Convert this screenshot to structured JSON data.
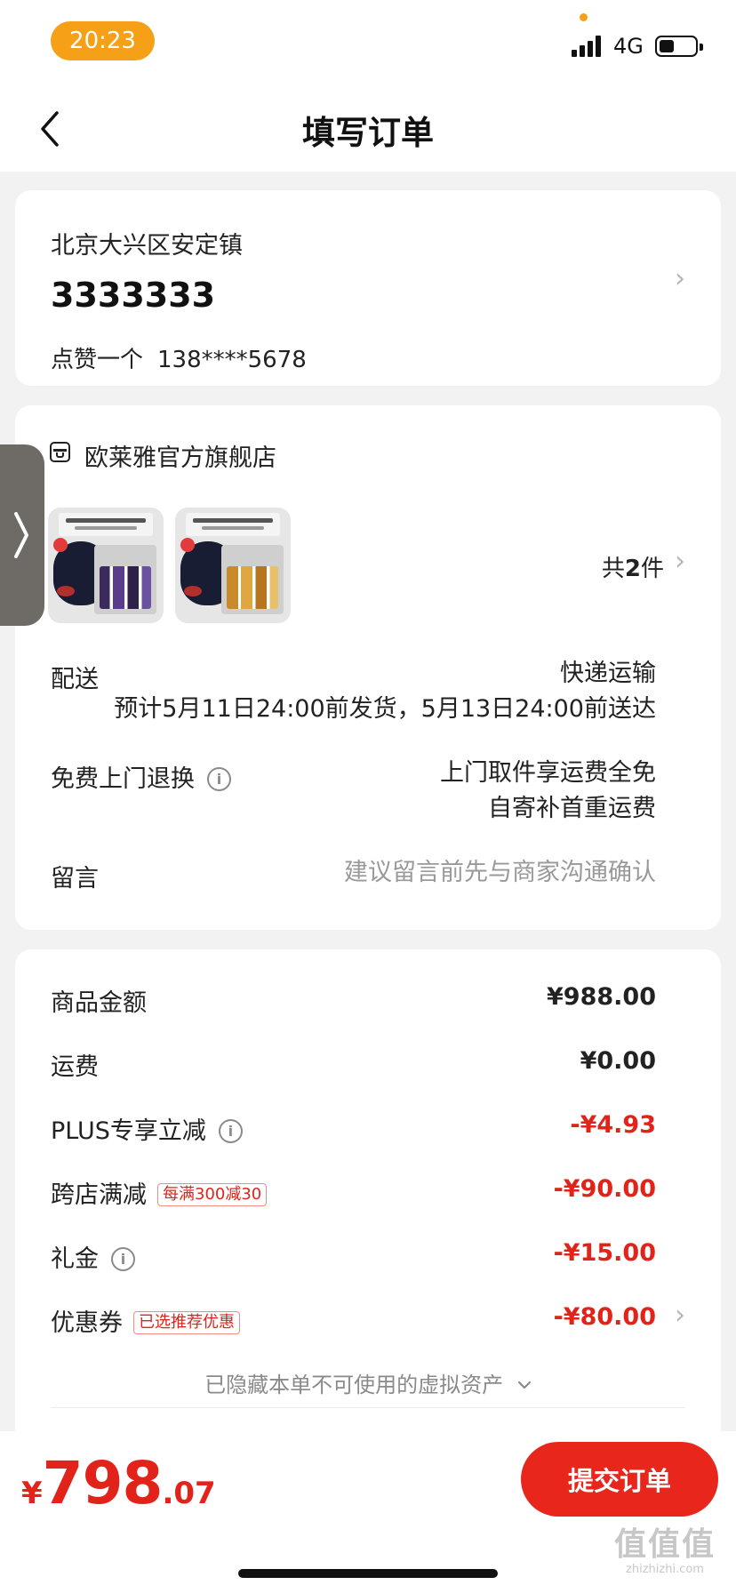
{
  "status_bar": {
    "time": "20:23",
    "network": "4G",
    "battery_level": 0.4
  },
  "nav": {
    "title": "填写订单"
  },
  "address": {
    "region": "北京大兴区安定镇",
    "detail": "3333333",
    "name": "点赞一个",
    "phone": "138****5678"
  },
  "shop": {
    "name": "欧莱雅官方旗舰店",
    "count_prefix": "共",
    "count": "2",
    "count_suffix": "件"
  },
  "delivery": {
    "label": "配送",
    "method": "快递运输",
    "eta": "预计5月11日24:00前发货，5月13日24:00前送达"
  },
  "return_service": {
    "label": "免费上门退换",
    "line1": "上门取件享运费全免",
    "line2": "自寄补首重运费"
  },
  "message": {
    "label": "留言",
    "placeholder": "建议留言前先与商家沟通确认"
  },
  "price": {
    "rows": [
      {
        "label": "商品金额",
        "amount": "¥988.00"
      },
      {
        "label": "运费",
        "amount": "¥0.00"
      },
      {
        "label": "PLUS专享立减",
        "amount": "-¥4.93"
      },
      {
        "label": "跨店满减",
        "badge": "每满300减30",
        "amount": "-¥90.00"
      },
      {
        "label": "礼金",
        "amount": "-¥15.00"
      },
      {
        "label": "优惠券",
        "badge": "已选推荐优惠",
        "amount": "-¥80.00"
      }
    ],
    "hidden_assets": "已隐藏本单不可使用的虚拟资产"
  },
  "total": {
    "currency": "¥",
    "integer": "798",
    "decimal": ".07"
  },
  "submit_label": "提交订单",
  "watermark": {
    "main": "值值值",
    "sub": "zhizhizhi.com"
  },
  "info_icon_glyph": "i",
  "colors": {
    "accent_red": "#e2231a",
    "button_red": "#e8261c",
    "time_orange": "#f5a016"
  }
}
